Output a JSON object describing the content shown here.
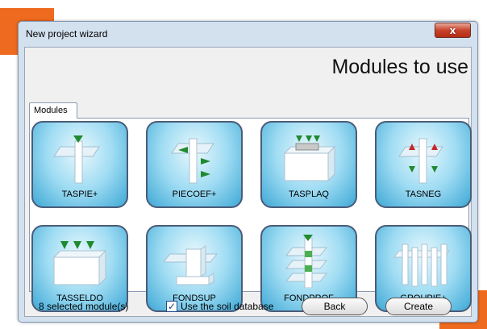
{
  "window": {
    "title": "New project wizard",
    "close_glyph": "x",
    "heading": "Modules to use",
    "tab_label": "Modules"
  },
  "modules": [
    {
      "label": "TASPIE+",
      "icon": "single-pile-icon"
    },
    {
      "label": "PIECOEF+",
      "icon": "pile-coefficient-icon"
    },
    {
      "label": "TASPLAQ",
      "icon": "plate-on-soil-icon"
    },
    {
      "label": "TASNEG",
      "icon": "negative-friction-icon"
    },
    {
      "label": "TASSELDO",
      "icon": "settlement-block-icon"
    },
    {
      "label": "FONDSUP",
      "icon": "shallow-foundation-icon"
    },
    {
      "label": "FONDPROF",
      "icon": "deep-foundation-icon"
    },
    {
      "label": "GROUPIE+",
      "icon": "pile-group-icon"
    }
  ],
  "footer": {
    "status": "8 selected module(s)",
    "checkbox_label": "Use the soil database",
    "checkbox_checked": true,
    "back_label": "Back",
    "create_label": "Create"
  },
  "colors": {
    "accent": "#ee6a1f",
    "module_face": "#6fc3e7",
    "arrow_green": "#1f8a2f",
    "arrow_red": "#c62828"
  }
}
